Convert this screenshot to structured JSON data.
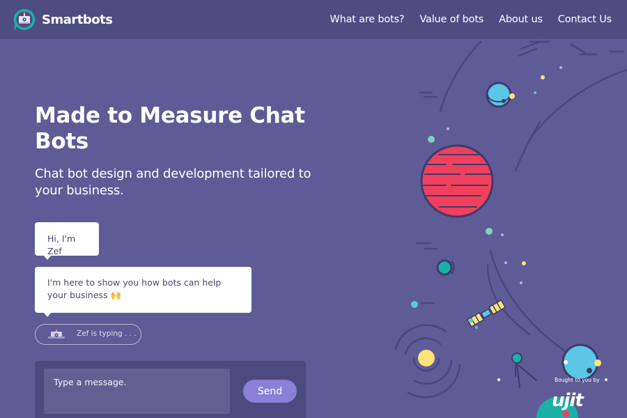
{
  "brand": {
    "name": "Smartbots"
  },
  "nav": {
    "items": [
      {
        "label": "What are bots?"
      },
      {
        "label": "Value of bots"
      },
      {
        "label": "About us"
      },
      {
        "label": "Contact Us"
      }
    ]
  },
  "hero": {
    "title": "Made to Measure Chat Bots",
    "subtitle": "Chat bot design and development tailored to your business."
  },
  "chat": {
    "messages": [
      {
        "text": "Hi, I'm Zef"
      },
      {
        "text": "I'm here to show you how bots can help your business 🙌"
      }
    ],
    "typing_status": "Zef is typing . . .",
    "input_placeholder": "Type a message.",
    "send_label": "Send"
  },
  "footer_credit": {
    "text": "Bought to you by",
    "logo_text": "ujit"
  },
  "colors": {
    "background": "#5e5b96",
    "header": "#4f4c82",
    "accent": "#8b7fd8",
    "planet_red": "#f0405c",
    "planet_blue": "#5bc6e6",
    "teal": "#1bb0a7",
    "yellow": "#fbe37a"
  },
  "icons": {
    "logo": "robot-chat-icon",
    "typing_avatar": "robot-icon"
  }
}
